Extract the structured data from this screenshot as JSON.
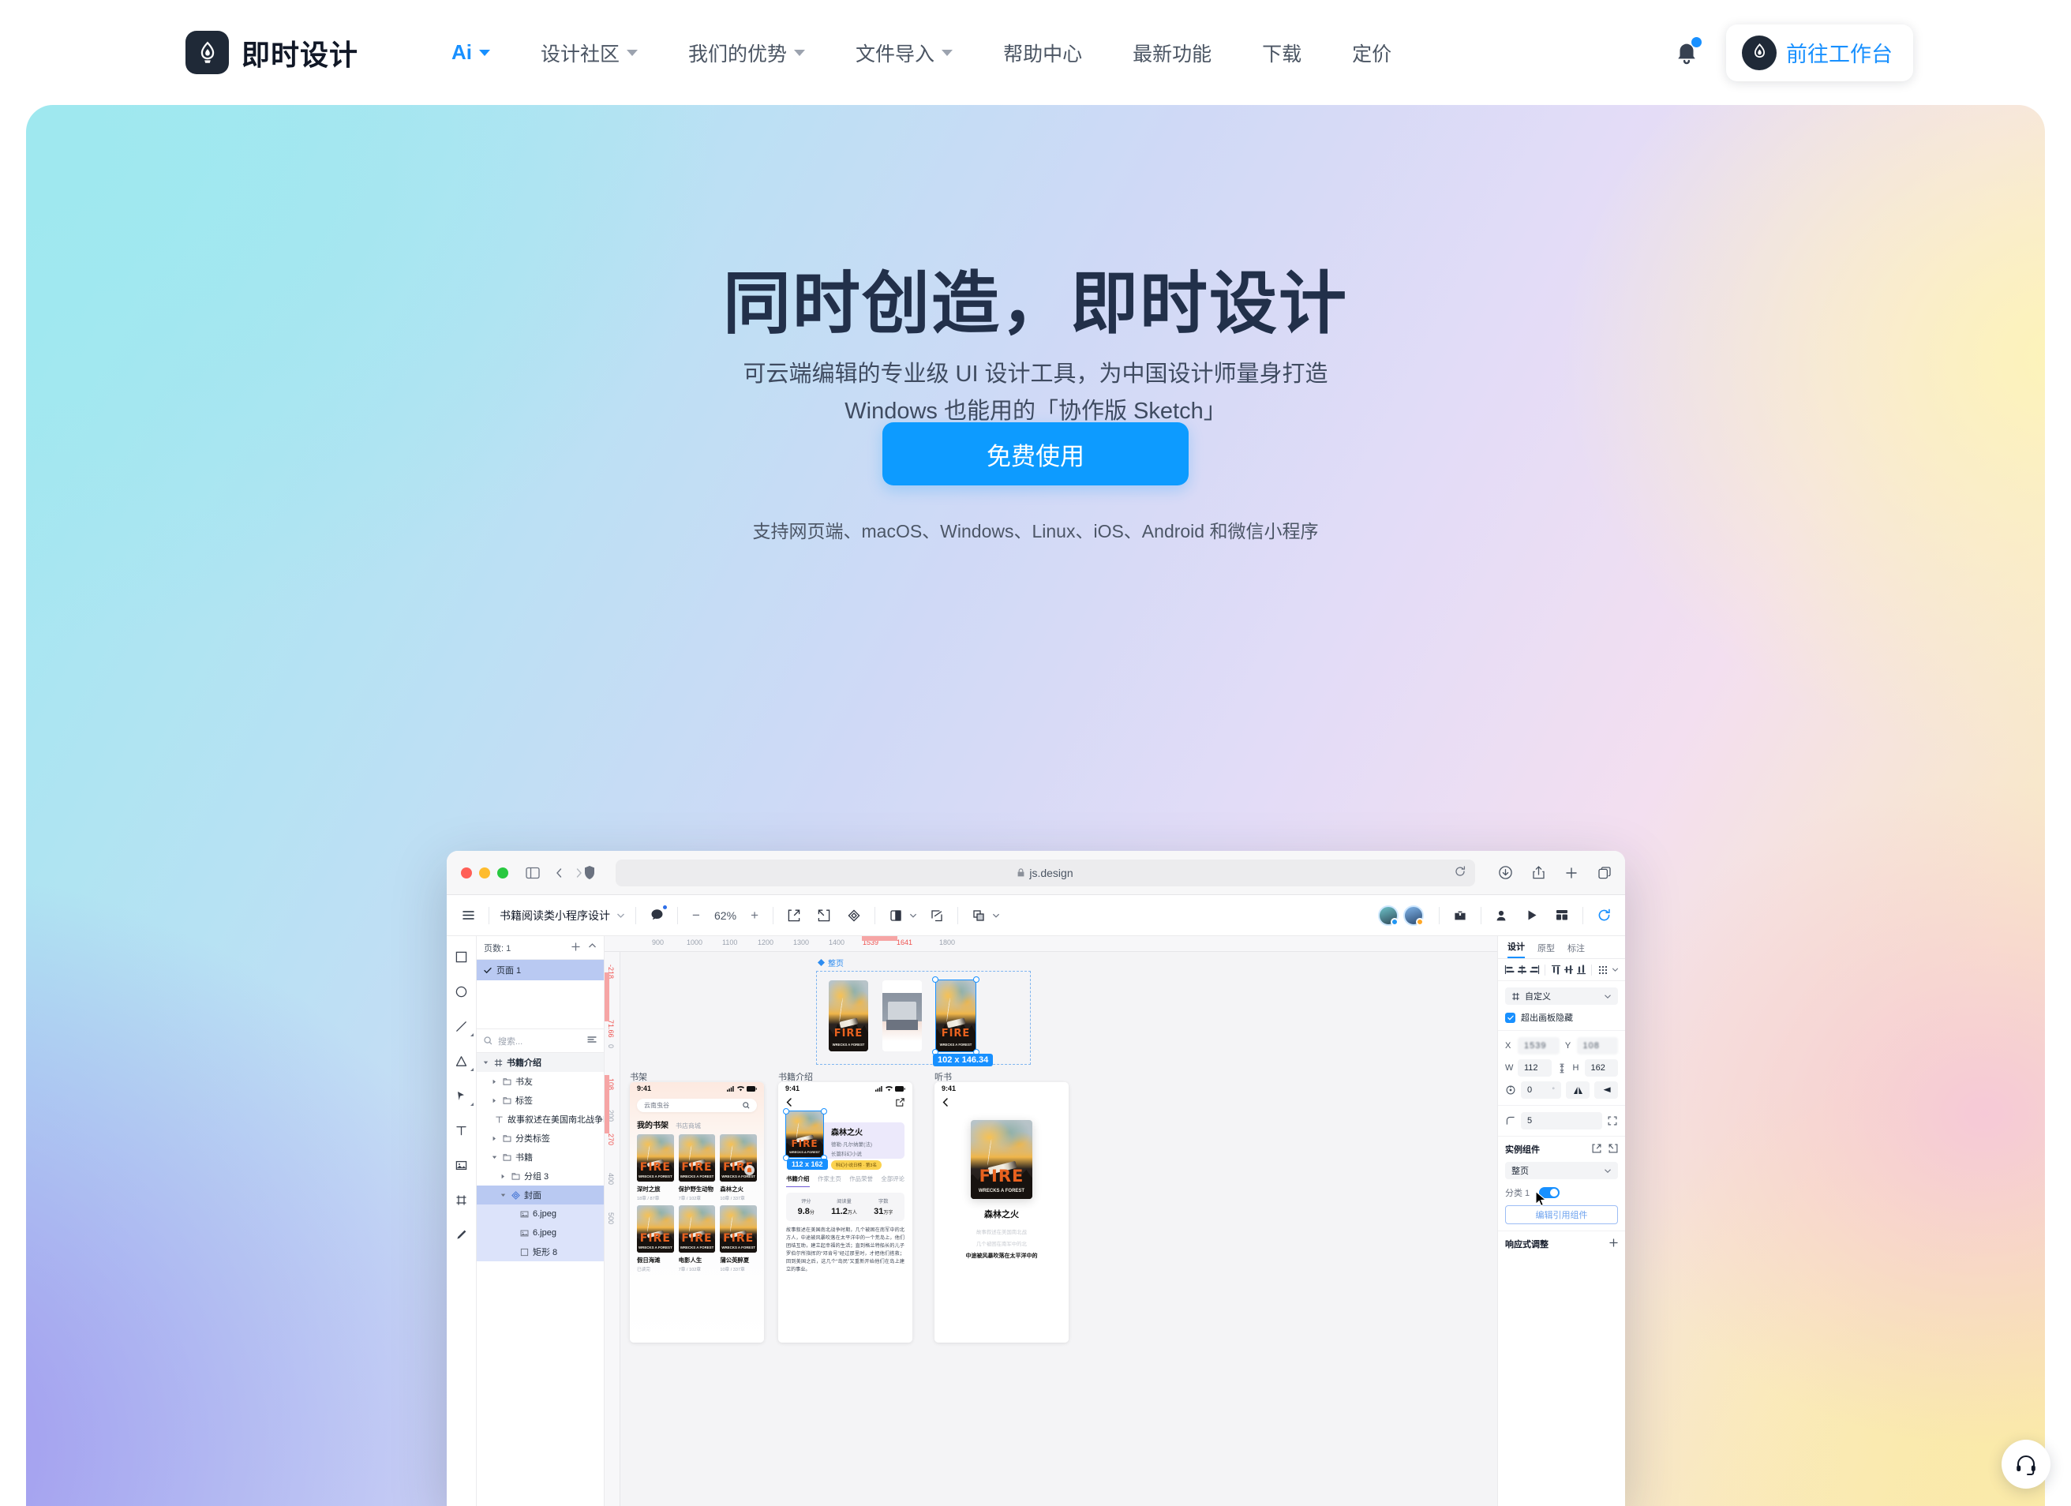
{
  "header": {
    "brand": "即时设计",
    "brand_icon": "jsdesign-logo-icon",
    "nav": [
      {
        "label": "Ai",
        "caret": true,
        "accent": true
      },
      {
        "label": "设计社区",
        "caret": true
      },
      {
        "label": "我们的优势",
        "caret": true
      },
      {
        "label": "文件导入",
        "caret": true
      },
      {
        "label": "帮助中心",
        "caret": false
      },
      {
        "label": "最新功能",
        "caret": false
      },
      {
        "label": "下载",
        "caret": false
      },
      {
        "label": "定价",
        "caret": false
      }
    ],
    "bell_icon": "notification-bell-icon",
    "workbench_label": "前往工作台"
  },
  "hero": {
    "title": "同时创造，即时设计",
    "subtitle_line1": "可云端编辑的专业级 UI 设计工具，为中国设计师量身打造",
    "subtitle_line2": "Windows 也能用的「协作版 Sketch」",
    "cta_label": "免费使用",
    "cta_color": "#0d9bff",
    "support_text": "支持网页端、macOS、Windows、Linux、iOS、Android 和微信小程序"
  },
  "app": {
    "browser": {
      "url": "js.design",
      "lock_icon": "lock-icon",
      "shield_icon": "shield-icon",
      "sidebar_icon": "sidebar-toggle-icon",
      "back_icon": "chevron-left-icon",
      "forward_icon": "chevron-right-icon",
      "reload_icon": "reload-icon",
      "right_icons": [
        "download-icon",
        "share-icon",
        "plus-icon",
        "tabs-icon"
      ]
    },
    "toolbar": {
      "menu_icon": "hamburger-menu-icon",
      "doc_name": "书籍阅读类小程序设计",
      "doc_caret": "chevron-down-icon",
      "comment_icon": "comment-bubble-icon",
      "zoom_out": "−",
      "zoom_value": "62%",
      "zoom_in": "+",
      "icons": [
        "export-icon",
        "import-icon",
        "component-icon",
        "mask-icon",
        "boolean-icon"
      ],
      "right_icons": [
        "toolbox-icon",
        "invite-user-icon",
        "play-icon",
        "layout-icon",
        "sync-icon"
      ]
    },
    "rail": [
      "rect-tool-icon",
      "ellipse-tool-icon",
      "line-tool-icon",
      "polygon-tool-icon",
      "pen-tool-icon",
      "text-tool-icon",
      "image-tool-icon",
      "frame-tool-icon",
      "pencil-tool-icon"
    ],
    "layers": {
      "pages_label": "页数: 1",
      "add_icon": "plus-icon",
      "collapse_icon": "chevron-up-icon",
      "page_name": "页面 1",
      "check_icon": "check-icon",
      "search_placeholder": "搜索...",
      "search_icon": "search-icon",
      "sort_icon": "sort-icon",
      "tree": [
        {
          "label": "书籍介绍",
          "icon": "frame-icon",
          "depth": 0,
          "twist": "down",
          "state": "root"
        },
        {
          "label": "书友",
          "icon": "group-icon",
          "depth": 1,
          "twist": "right",
          "state": ""
        },
        {
          "label": "标签",
          "icon": "group-icon",
          "depth": 1,
          "twist": "right",
          "state": ""
        },
        {
          "label": "故事叙述在美国南北战争时…",
          "icon": "text-icon",
          "depth": 1,
          "twist": "",
          "state": ""
        },
        {
          "label": "分类标签",
          "icon": "group-icon",
          "depth": 1,
          "twist": "right",
          "state": ""
        },
        {
          "label": "书籍",
          "icon": "group-icon",
          "depth": 1,
          "twist": "down",
          "state": ""
        },
        {
          "label": "分组 3",
          "icon": "group-icon",
          "depth": 2,
          "twist": "right",
          "state": ""
        },
        {
          "label": "封面",
          "icon": "component-icon",
          "depth": 2,
          "twist": "down",
          "state": "sel"
        },
        {
          "label": "6.jpeg",
          "icon": "image-icon",
          "depth": 3,
          "twist": "",
          "state": "child-sel"
        },
        {
          "label": "6.jpeg",
          "icon": "image-icon",
          "depth": 3,
          "twist": "",
          "state": "child-sel"
        },
        {
          "label": "矩形 8",
          "icon": "rect-icon",
          "depth": 3,
          "twist": "",
          "state": "child-sel"
        }
      ]
    },
    "canvas": {
      "ruler_h": [
        "900",
        "1000",
        "1100",
        "1200",
        "1300",
        "1400",
        "1539",
        "1641",
        "1800"
      ],
      "ruler_h_red": [
        "1539",
        "1641"
      ],
      "ruler_v": [
        "-218",
        "71.66",
        "0",
        "108",
        "200",
        "270",
        "400",
        "500"
      ],
      "ruler_v_red": [
        "-218",
        "71.66",
        "108",
        "270"
      ],
      "component_label": "整页",
      "selection_size_top": "102 x 146.34",
      "selection_size_phone": "112 x 162",
      "artboard_titles": [
        "书架",
        "书籍介绍",
        "听书"
      ]
    },
    "phone1": {
      "time": "9:41",
      "search_value": "云南虫谷",
      "search_icon": "search-icon",
      "tabs": [
        "我的书架",
        "书店商城"
      ],
      "books": [
        {
          "title": "深时之旅",
          "meta": "18章 / 87章"
        },
        {
          "title": "保护野生动物",
          "meta": "7章 / 102章"
        },
        {
          "title": "森林之火",
          "meta": "10章 / 337章"
        },
        {
          "title": "假日海滩",
          "meta": "已读完"
        },
        {
          "title": "电影人生",
          "meta": "7章 / 102章"
        },
        {
          "title": "蒲公英醉夏",
          "meta": "10章 / 337章"
        }
      ]
    },
    "phone2": {
      "time": "9:41",
      "back_icon": "chevron-left-icon",
      "share_icon": "share-out-icon",
      "book_title": "森林之火",
      "book_author": "德勒·凡尔纳蒙(法)",
      "book_genre": "长篇科幻小说",
      "book_badge": "科幻小说日榜 · 第3名",
      "tabs": [
        "书籍介绍",
        "作家主页",
        "作品荣誉",
        "全部评论"
      ],
      "stats": [
        {
          "label": "评分",
          "value": "9.8",
          "unit": "分"
        },
        {
          "label": "阅读量",
          "value": "11.2",
          "unit": "万人"
        },
        {
          "label": "字数",
          "value": "31",
          "unit": "万字"
        }
      ],
      "description": "故事叙述在美国南北战争时期，几个被困在南军中的北方人，中途被风暴吹落在太平洋中的一个荒岛上，他们团结互助，建立起幸福的生活；直到格兰特船长的儿子罗伯尔所指挥的“邓肯号”经过那里时，才把他们搭救；回到美国之后，这几个“岛民”又重新开始他们在岛上建立的事业。"
    },
    "phone3": {
      "time": "9:41",
      "back_icon": "chevron-left-icon",
      "book_title": "森林之火",
      "lines": [
        "故事叙述在美国南北战",
        "几个被困在南军中的北",
        "中途被风暴吹落在太平洋中的"
      ]
    },
    "poster": {
      "word": "FIRE",
      "sub": "WRECKS A FOREST"
    },
    "props": {
      "tabs": [
        "设计",
        "原型",
        "标注"
      ],
      "active_tab": "设计",
      "align_icons": [
        "align-left-icon",
        "align-center-h-icon",
        "align-right-icon",
        "align-top-icon",
        "align-center-v-icon",
        "align-bottom-icon",
        "distribute-icon"
      ],
      "preset_label": "自定义",
      "preset_icon": "resize-icon",
      "clip_label": "超出画板隐藏",
      "clip_checked": true,
      "x_label": "X",
      "x_value": "1539",
      "y_label": "Y",
      "y_value": "108",
      "w_label": "W",
      "w_value": "112",
      "h_label": "H",
      "h_value": "162",
      "link_icon": "link-ratio-icon",
      "rotation_icon": "rotation-icon",
      "rotation_value": "0",
      "rotation_unit": "°",
      "flip_h_icon": "flip-horizontal-icon",
      "flip_v_icon": "flip-vertical-icon",
      "corner_icon": "corner-radius-icon",
      "corner_value": "5",
      "corner_expand_icon": "corner-independent-icon",
      "instance_title": "实例组件",
      "instance_action_icons": [
        "detach-icon",
        "reset-icon"
      ],
      "instance_value": "整页",
      "variant_label": "分类 1",
      "variant_on": true,
      "edit_ref_label": "编辑引用组件",
      "responsive_title": "响应式调整",
      "responsive_add_icon": "plus-icon"
    }
  },
  "fab": {
    "icon": "headset-support-icon"
  }
}
